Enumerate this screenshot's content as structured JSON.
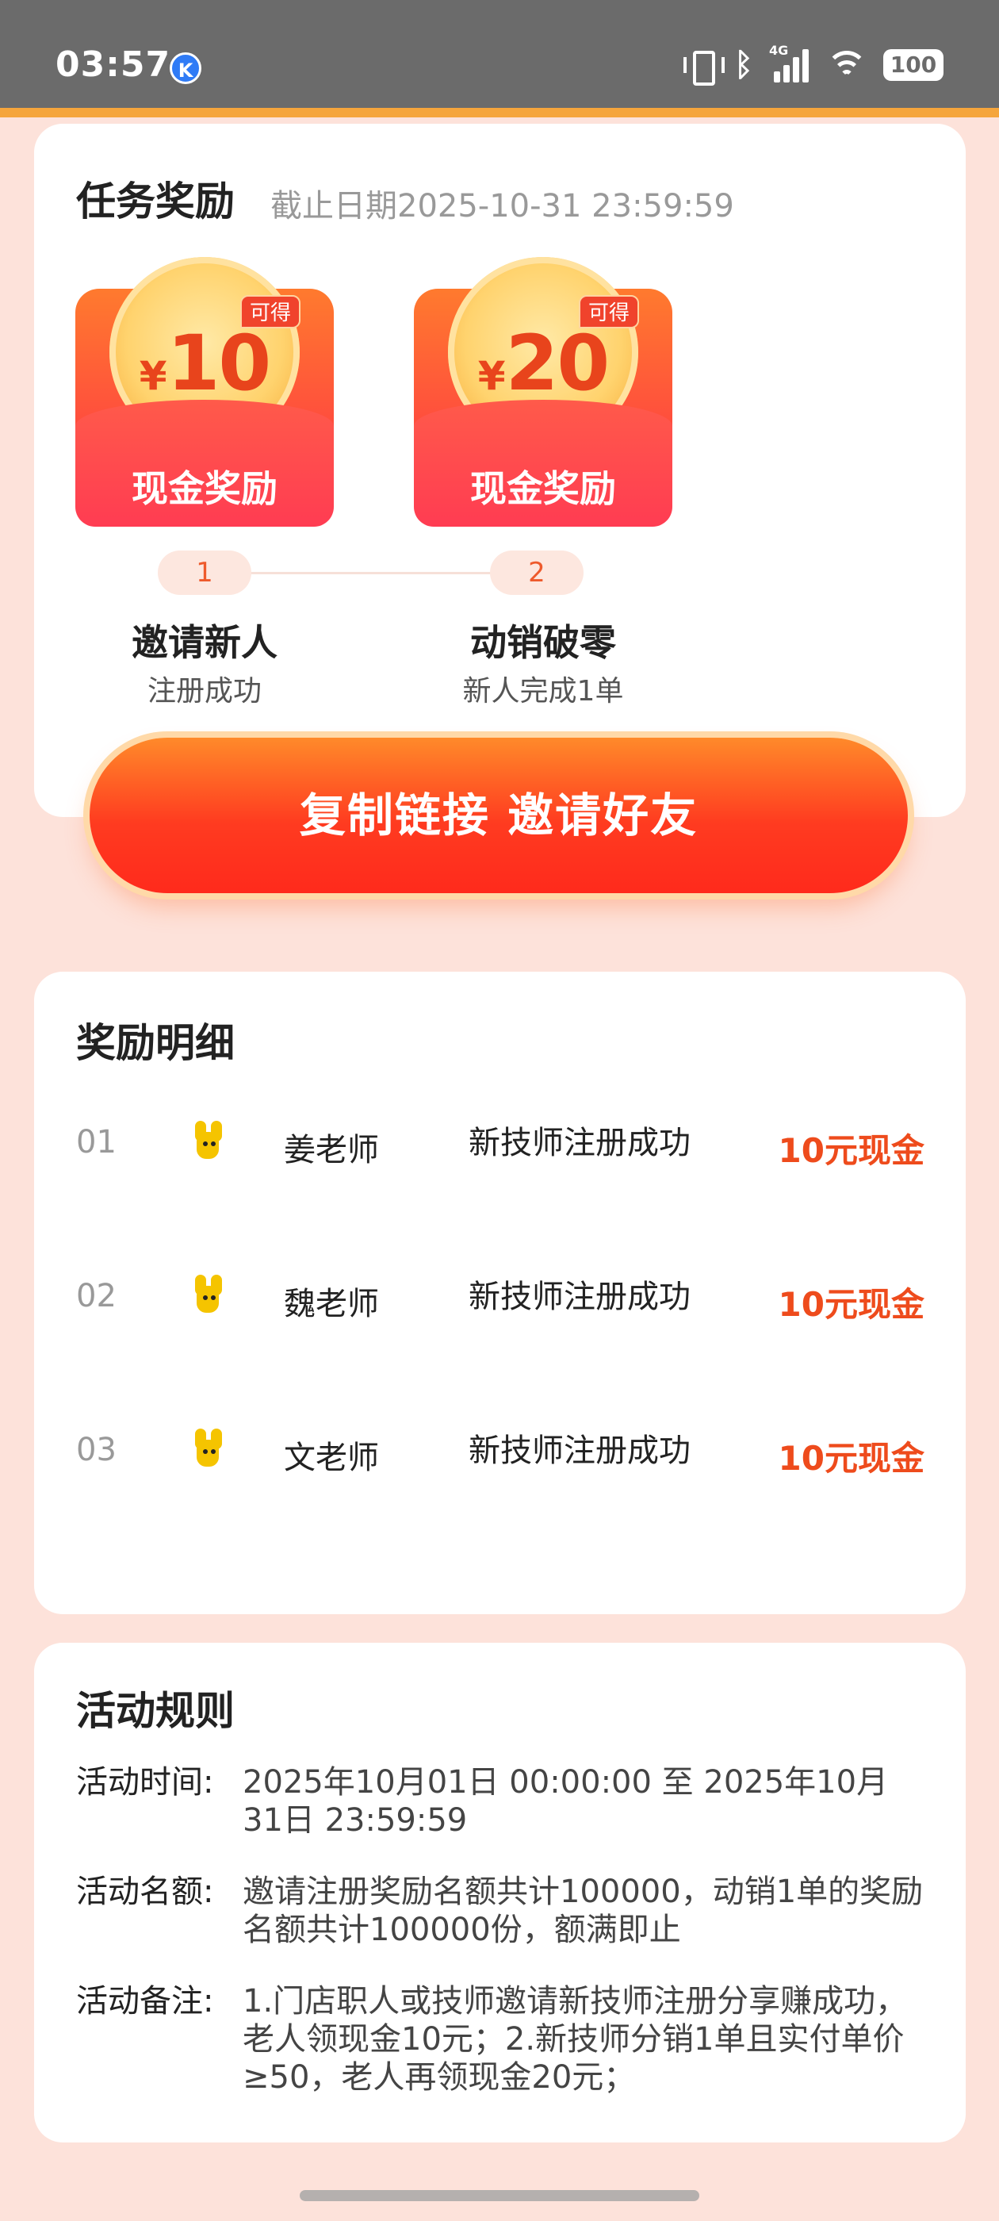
{
  "status_bar": {
    "time": "03:57",
    "app_badge": "K",
    "network": "4G",
    "battery": "100"
  },
  "task_reward": {
    "title": "任务奖励",
    "deadline": "截止日期2025-10-31 23:59:59",
    "rewards": [
      {
        "currency": "¥",
        "amount": "10",
        "badge": "可得",
        "label": "现金奖励",
        "step": "1",
        "name": "邀请新人",
        "desc": "注册成功"
      },
      {
        "currency": "¥",
        "amount": "20",
        "badge": "可得",
        "label": "现金奖励",
        "step": "2",
        "name": "动销破零",
        "desc": "新人完成1单"
      }
    ],
    "cta_label": "复制链接 邀请好友"
  },
  "reward_detail": {
    "title": "奖励明细",
    "rows": [
      {
        "index": "01",
        "name": "姜老师",
        "desc": "新技师注册成功",
        "amount": "10元现金"
      },
      {
        "index": "02",
        "name": "魏老师",
        "desc": "新技师注册成功",
        "amount": "10元现金"
      },
      {
        "index": "03",
        "name": "文老师",
        "desc": "新技师注册成功",
        "amount": "10元现金"
      }
    ]
  },
  "rules": {
    "title": "活动规则",
    "items": [
      {
        "key": "活动时间:",
        "value": "2025年10月01日 00:00:00 至 2025年10月31日 23:59:59"
      },
      {
        "key": "活动名额:",
        "value": "邀请注册奖励名额共计100000，动销1单的奖励名额共计100000份，额满即止"
      },
      {
        "key": "活动备注:",
        "value": "1.门店职人或技师邀请新技师注册分享赚成功，老人领现金10元；2.新技师分销1单且实付单价≥50，老人再领现金20元；"
      }
    ]
  },
  "colors": {
    "accent": "#ee4b1c",
    "background": "#fde2da",
    "cta": "#ff3b20"
  }
}
